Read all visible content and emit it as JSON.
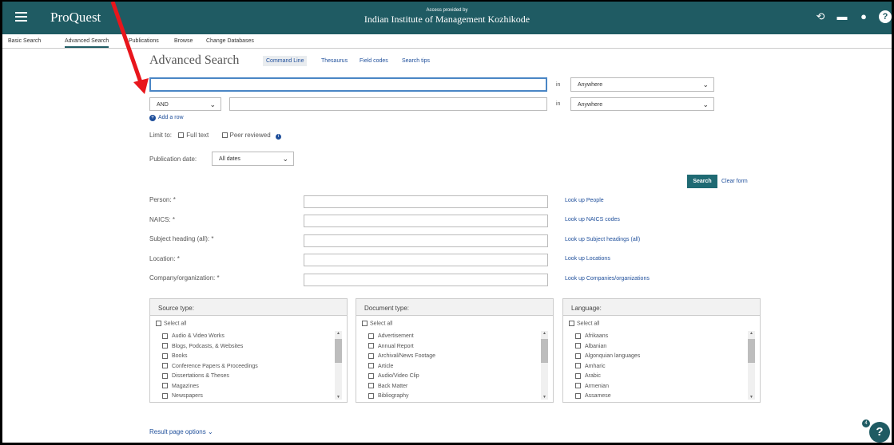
{
  "header": {
    "logo": "ProQuest",
    "access_small": "Access provided by",
    "institution": "Indian Institute of Management Kozhikode",
    "icons": [
      "history-icon",
      "folder-icon",
      "user-icon",
      "help-icon"
    ]
  },
  "subnav": {
    "items": [
      "Basic Search",
      "Advanced Search",
      "Publications",
      "Browse",
      "Change Databases"
    ]
  },
  "page": {
    "title": "Advanced Search",
    "command_line": "Command Line",
    "thesaurus": "Thesaurus",
    "field_codes": "Field codes",
    "search_tips": "Search tips"
  },
  "rows": {
    "in_label": "in",
    "field_1": "Anywhere",
    "operator": "AND",
    "field_2": "Anywhere",
    "add_row": "Add a row"
  },
  "limit": {
    "label": "Limit to:",
    "full_text": "Full text",
    "peer_reviewed": "Peer reviewed"
  },
  "pubdate": {
    "label": "Publication date:",
    "value": "All dates"
  },
  "actions": {
    "search": "Search",
    "clear": "Clear form"
  },
  "fields": [
    {
      "label": "Person: *",
      "lookup": "Look up People"
    },
    {
      "label": "NAICS: *",
      "lookup": "Look up NAICS codes"
    },
    {
      "label": "Subject heading (all): *",
      "lookup": "Look up Subject headings (all)"
    },
    {
      "label": "Location: *",
      "lookup": "Look up Locations"
    },
    {
      "label": "Company/organization: *",
      "lookup": "Look up Companies/organizations"
    }
  ],
  "panels": {
    "select_all": "Select all",
    "source": {
      "title": "Source type:",
      "items": [
        "Audio & Video Works",
        "Blogs, Podcasts, & Websites",
        "Books",
        "Conference Papers & Proceedings",
        "Dissertations & Theses",
        "Magazines",
        "Newspapers"
      ]
    },
    "document": {
      "title": "Document type:",
      "items": [
        "Advertisement",
        "Annual Report",
        "Archival/News Footage",
        "Article",
        "Audio/Video Clip",
        "Back Matter",
        "Bibliography"
      ]
    },
    "language": {
      "title": "Language:",
      "items": [
        "Afrikaans",
        "Albanian",
        "Algonquian languages",
        "Amharic",
        "Arabic",
        "Armenian",
        "Assamese"
      ]
    }
  },
  "footer": {
    "result_options": "Result page options",
    "chat_badge": "4",
    "chat_label": "?"
  },
  "colors": {
    "header": "#1f5b63",
    "link": "#1f4f9b",
    "annotation_arrow": "#e8161c"
  }
}
